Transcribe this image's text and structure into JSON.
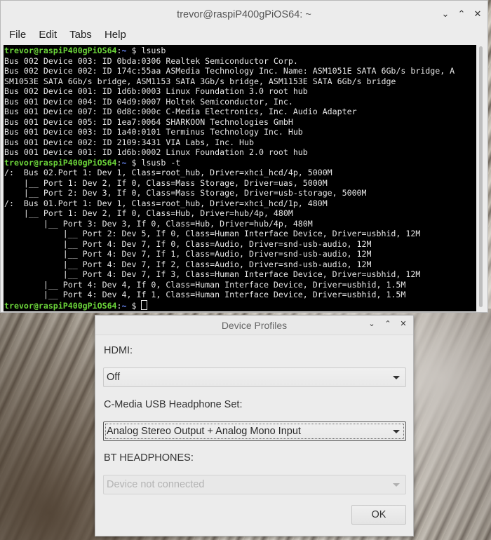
{
  "terminal": {
    "title": "trevor@raspiP400gPiOS64: ~",
    "menu": [
      "File",
      "Edit",
      "Tabs",
      "Help"
    ],
    "prompt_user": "trevor@raspiP400gPiOS64",
    "prompt_sep": ":",
    "prompt_path": "~",
    "prompt_end": " $ ",
    "cmd1": "lsusb",
    "cmd2": "lsusb -t",
    "lsusb_output": [
      "Bus 002 Device 003: ID 0bda:0306 Realtek Semiconductor Corp.",
      "Bus 002 Device 002: ID 174c:55aa ASMedia Technology Inc. Name: ASM1051E SATA 6Gb/s bridge, A",
      "SM1053E SATA 6Gb/s bridge, ASM1153 SATA 3Gb/s bridge, ASM1153E SATA 6Gb/s bridge",
      "Bus 002 Device 001: ID 1d6b:0003 Linux Foundation 3.0 root hub",
      "Bus 001 Device 004: ID 04d9:0007 Holtek Semiconductor, Inc.",
      "Bus 001 Device 007: ID 0d8c:000c C-Media Electronics, Inc. Audio Adapter",
      "Bus 001 Device 005: ID 1ea7:0064 SHARKOON Technologies GmbH",
      "Bus 001 Device 003: ID 1a40:0101 Terminus Technology Inc. Hub",
      "Bus 001 Device 002: ID 2109:3431 VIA Labs, Inc. Hub",
      "Bus 001 Device 001: ID 1d6b:0002 Linux Foundation 2.0 root hub"
    ],
    "tree_output": [
      "/:  Bus 02.Port 1: Dev 1, Class=root_hub, Driver=xhci_hcd/4p, 5000M",
      "    |__ Port 1: Dev 2, If 0, Class=Mass Storage, Driver=uas, 5000M",
      "    |__ Port 2: Dev 3, If 0, Class=Mass Storage, Driver=usb-storage, 5000M",
      "/:  Bus 01.Port 1: Dev 1, Class=root_hub, Driver=xhci_hcd/1p, 480M",
      "    |__ Port 1: Dev 2, If 0, Class=Hub, Driver=hub/4p, 480M",
      "        |__ Port 3: Dev 3, If 0, Class=Hub, Driver=hub/4p, 480M",
      "            |__ Port 2: Dev 5, If 0, Class=Human Interface Device, Driver=usbhid, 12M",
      "            |__ Port 4: Dev 7, If 0, Class=Audio, Driver=snd-usb-audio, 12M",
      "            |__ Port 4: Dev 7, If 1, Class=Audio, Driver=snd-usb-audio, 12M",
      "            |__ Port 4: Dev 7, If 2, Class=Audio, Driver=snd-usb-audio, 12M",
      "            |__ Port 4: Dev 7, If 3, Class=Human Interface Device, Driver=usbhid, 12M",
      "        |__ Port 4: Dev 4, If 0, Class=Human Interface Device, Driver=usbhid, 1.5M",
      "        |__ Port 4: Dev 4, If 1, Class=Human Interface Device, Driver=usbhid, 1.5M"
    ]
  },
  "dialog": {
    "title": "Device Profiles",
    "hdmi_label": "HDMI:",
    "hdmi_value": "Off",
    "cmedia_label": "C-Media USB Headphone Set:",
    "cmedia_value": "Analog Stereo Output + Analog Mono Input",
    "bt_label": "BT HEADPHONES:",
    "bt_value": "Device not connected",
    "ok_label": "OK"
  },
  "window_buttons": {
    "minimize": "⌄",
    "maximize": "⌃",
    "close": "✕"
  }
}
